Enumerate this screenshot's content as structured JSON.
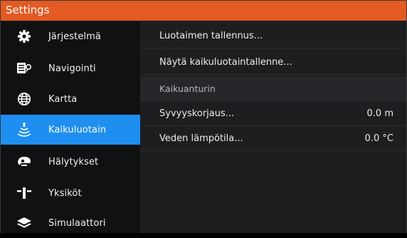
{
  "window": {
    "title": "Settings"
  },
  "sidebar": {
    "items": [
      {
        "label": "Järjestelmä",
        "icon": "gear-icon",
        "active": false
      },
      {
        "label": "Navigointi",
        "icon": "navigation-icon",
        "active": false
      },
      {
        "label": "Kartta",
        "icon": "globe-icon",
        "active": false
      },
      {
        "label": "Kaikuluotain",
        "icon": "sonar-icon",
        "active": true
      },
      {
        "label": "Hälytykset",
        "icon": "alarm-icon",
        "active": false
      },
      {
        "label": "Yksiköt",
        "icon": "units-icon",
        "active": false
      },
      {
        "label": "Simulaattori",
        "icon": "layers-icon",
        "active": false
      }
    ]
  },
  "panel": {
    "rows": [
      {
        "label": "Luotaimen tallennus...",
        "value": ""
      },
      {
        "label": "Näytä kaikuluotaintallenne...",
        "value": ""
      },
      {
        "label": "Kaikuanturin",
        "value": "",
        "header": true
      },
      {
        "label": "Syvyyskorjaus...",
        "value": "0.0 m"
      },
      {
        "label": "Veden lämpötila...",
        "value": "0.0 °C"
      }
    ]
  },
  "colors": {
    "titlebar": "#e35a23",
    "accent": "#1e8ff0",
    "sidebar_bg": "#101112",
    "panel_bg": "#1d1e20"
  }
}
